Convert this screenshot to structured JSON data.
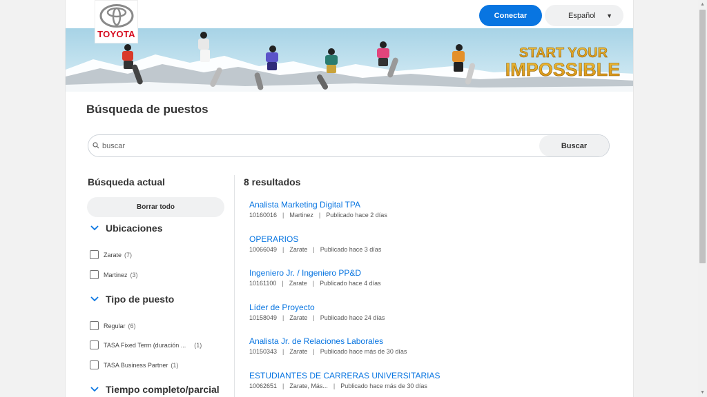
{
  "header": {
    "logo_text": "TOYOTA",
    "connect_label": "Conectar",
    "language_label": "Español"
  },
  "banner": {
    "tagline_line1": "START YOUR",
    "tagline_line2": "IMPOSSIBLE"
  },
  "page_title": "Búsqueda de puestos",
  "search": {
    "placeholder": "buscar",
    "button_label": "Buscar"
  },
  "sidebar": {
    "title": "Búsqueda actual",
    "clear_label": "Borrar todo",
    "facets": [
      {
        "title": "Ubicaciones",
        "options": [
          {
            "label": "Zarate",
            "count": "(7)"
          },
          {
            "label": "Martinez",
            "count": "(3)"
          }
        ]
      },
      {
        "title": "Tipo de puesto",
        "options": [
          {
            "label": "Regular",
            "count": "(6)"
          },
          {
            "label": "TASA Fixed Term (duración ...",
            "count": "(1)"
          },
          {
            "label": "TASA Business Partner",
            "count": "(1)"
          }
        ]
      },
      {
        "title": "Tiempo completo/parcial",
        "options": []
      }
    ]
  },
  "results": {
    "count_label": "8 resultados",
    "jobs": [
      {
        "title": "Analista Marketing Digital TPA",
        "id": "10160016",
        "location": "Martinez",
        "posted": "Publicado hace 2 días"
      },
      {
        "title": "OPERARIOS",
        "id": "10066049",
        "location": "Zarate",
        "posted": "Publicado hace 3 días"
      },
      {
        "title": "Ingeniero Jr. / Ingeniero PP&D",
        "id": "10161100",
        "location": "Zarate",
        "posted": "Publicado hace 4 días"
      },
      {
        "title": "Líder de Proyecto",
        "id": "10158049",
        "location": "Zarate",
        "posted": "Publicado hace 24 días"
      },
      {
        "title": "Analista Jr. de Relaciones Laborales",
        "id": "10150343",
        "location": "Zarate",
        "posted": "Publicado hace más de 30 días"
      },
      {
        "title": "ESTUDIANTES DE CARRERAS UNIVERSITARIAS",
        "id": "10062651",
        "location": "Zarate, Más...",
        "posted": "Publicado hace más de 30 días"
      }
    ]
  },
  "colors": {
    "accent": "#0875e1",
    "brand_red": "#d60b1e",
    "tagline": "#e0a01f"
  }
}
